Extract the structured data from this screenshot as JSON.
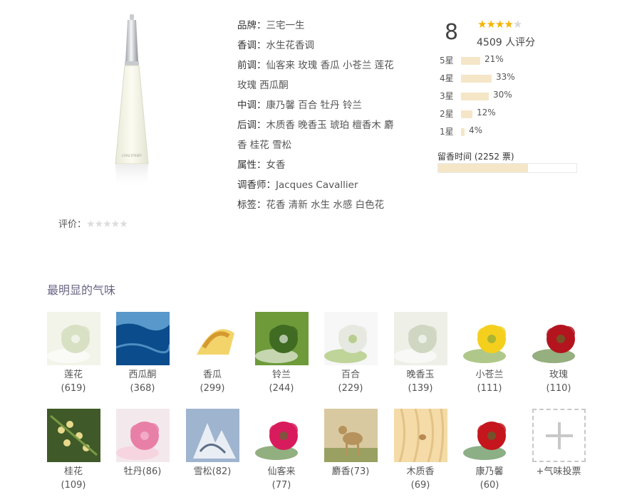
{
  "product": {
    "rate_label": "评价：",
    "user_stars": "★★★★★"
  },
  "attributes": [
    {
      "label": "品牌：",
      "value": "三宅一生"
    },
    {
      "label": "香调：",
      "value": "水生花香调"
    },
    {
      "label": "前调：",
      "value": "仙客来 玫瑰 香瓜 小苍兰 莲花"
    },
    {
      "label": "",
      "value": "玫瑰 西瓜酮"
    },
    {
      "label": "中调：",
      "value": "康乃馨 百合 牡丹 铃兰"
    },
    {
      "label": "后调：",
      "value": "木质香 晚香玉 琥珀 檀香木 麝"
    },
    {
      "label": "",
      "value": "香 桂花 雪松"
    },
    {
      "label": "属性：",
      "value": "女香"
    },
    {
      "label": "调香师：",
      "value": "Jacques Cavallier"
    },
    {
      "label": "标签：",
      "value": "花香 清新 水生 水感 白色花"
    }
  ],
  "rating": {
    "score": "8",
    "stars_filled": 4,
    "stars_total": 5,
    "votes_text": "4509 人评分",
    "distribution": [
      {
        "label": "5星",
        "pct": 21,
        "pct_text": "21%"
      },
      {
        "label": "4星",
        "pct": 33,
        "pct_text": "33%"
      },
      {
        "label": "3星",
        "pct": 30,
        "pct_text": "30%"
      },
      {
        "label": "2星",
        "pct": 12,
        "pct_text": "12%"
      },
      {
        "label": "1星",
        "pct": 4,
        "pct_text": "4%"
      }
    ],
    "longevity_title": "留香时间 (2252 票)",
    "longevity_fill": 0.65
  },
  "notes_section": {
    "title": "最明显的气味",
    "notes": [
      {
        "icon": "lotus-icon",
        "label": "莲花(619)",
        "colors": [
          "#f2f4ea",
          "#d8e0c4",
          "#ffffff"
        ]
      },
      {
        "icon": "melon-water-icon",
        "label": "西瓜酮(368)",
        "colors": [
          "#1f74b8",
          "#0b4c8c",
          "#79b9e6"
        ]
      },
      {
        "icon": "cantaloupe-icon",
        "label": "香瓜(299)",
        "colors": [
          "#ffffff",
          "#f2d46a",
          "#d59a2f"
        ]
      },
      {
        "icon": "lily-of-the-valley-icon",
        "label": "铃兰(244)",
        "colors": [
          "#6e9a3a",
          "#3f6b22",
          "#ffffff"
        ]
      },
      {
        "icon": "lily-icon",
        "label": "百合(229)",
        "colors": [
          "#f7f7f7",
          "#e6e9e1",
          "#9abc5a"
        ]
      },
      {
        "icon": "tuberose-icon",
        "label": "晚香玉(139)",
        "colors": [
          "#eef0e8",
          "#cfd6c2",
          "#ffffff"
        ]
      },
      {
        "icon": "freesia-icon",
        "label": "小苍兰(111)",
        "colors": [
          "#ffffff",
          "#f4cf1e",
          "#7aa33b"
        ]
      },
      {
        "icon": "rose-icon",
        "label": "玫瑰(110)",
        "colors": [
          "#ffffff",
          "#b3141e",
          "#4f7a2a"
        ]
      },
      {
        "icon": "osmanthus-icon",
        "label": "桂花(109)",
        "colors": [
          "#3f5a28",
          "#e8d98c",
          "#7a9a45"
        ]
      },
      {
        "icon": "peony-icon",
        "label": "牡丹(86)",
        "colors": [
          "#f3e9ec",
          "#e87fa7",
          "#f8c6d8"
        ]
      },
      {
        "icon": "cedar-icon",
        "label": "雪松(82)",
        "colors": [
          "#9fb4cf",
          "#e9eef5",
          "#5d6f86"
        ]
      },
      {
        "icon": "cyclamen-icon",
        "label": "仙客来(77)",
        "colors": [
          "#ffffff",
          "#d81b5c",
          "#4a7a2c"
        ]
      },
      {
        "icon": "musk-deer-icon",
        "label": "麝香(73)",
        "colors": [
          "#d9c9a0",
          "#b6935c",
          "#7d8f47"
        ]
      },
      {
        "icon": "wood-icon",
        "label": "木质香(69)",
        "colors": [
          "#f4dba7",
          "#e3c286",
          "#b78a52"
        ]
      },
      {
        "icon": "carnation-icon",
        "label": "康乃馨(60)",
        "colors": [
          "#ffffff",
          "#c4161c",
          "#3f7a35"
        ]
      },
      {
        "icon": "plus-icon",
        "label": "+气味投票",
        "vote": true
      }
    ]
  }
}
